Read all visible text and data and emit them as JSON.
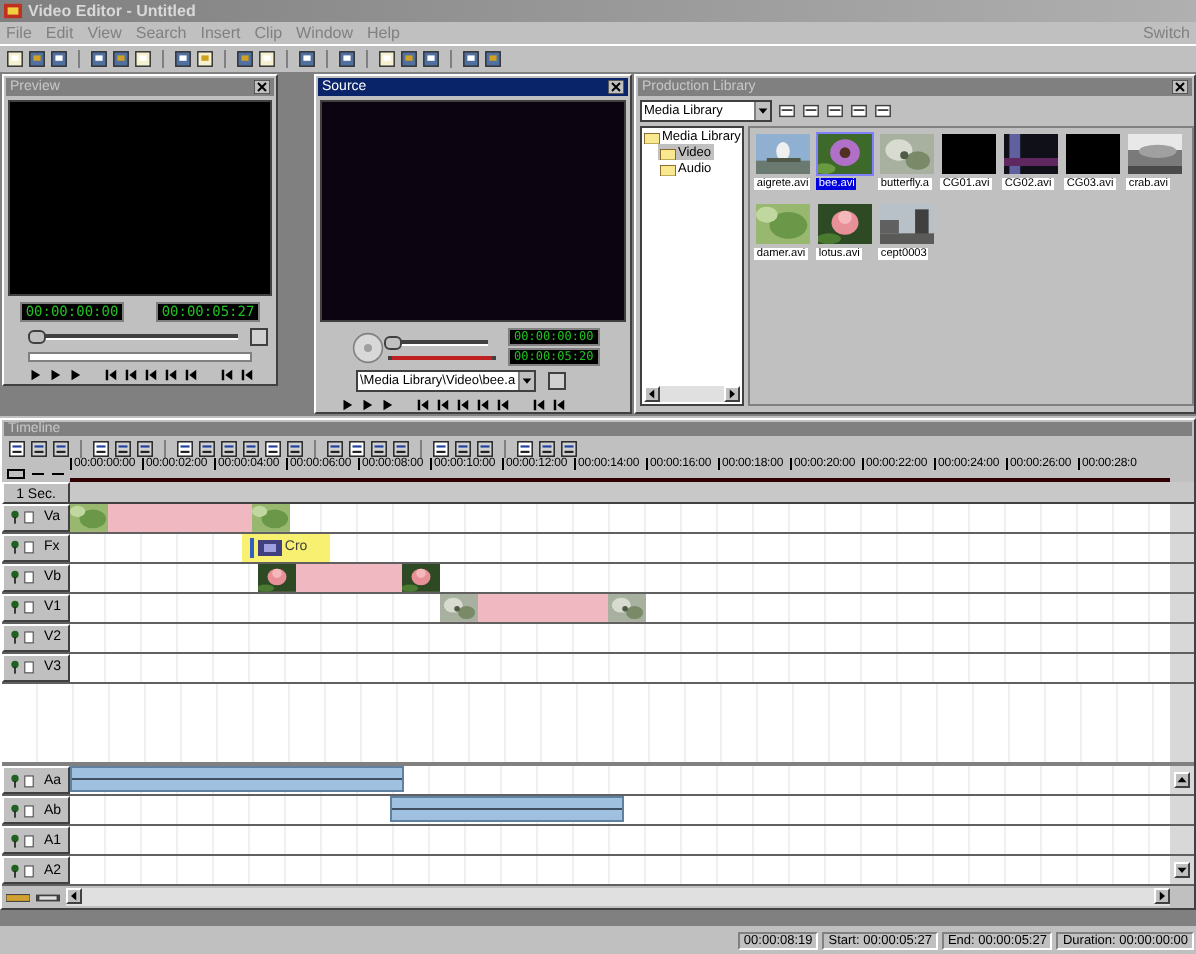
{
  "window": {
    "title": "Video Editor - Untitled"
  },
  "menu": {
    "disabled": true,
    "right": "Switch",
    "items": [
      "File",
      "Edit",
      "View",
      "Search",
      "Insert",
      "Clip",
      "Window",
      "Help"
    ]
  },
  "preview": {
    "title": "Preview",
    "active": false,
    "timecode_current": "00:00:00:00",
    "timecode_end": "00:00:05:27",
    "level": 0.04
  },
  "source": {
    "title": "Source",
    "active": true,
    "timecode_in": "00:00:00:00",
    "timecode_out": "00:00:05:20",
    "level": 0.04,
    "path": "\\Media Library\\Video\\bee.a"
  },
  "library": {
    "title": "Production Library",
    "active": false,
    "dropdown": "Media Library",
    "tree": [
      {
        "label": "Media Library",
        "expanded": true,
        "selected": false,
        "children": [
          {
            "label": "Video",
            "selected": true
          },
          {
            "label": "Audio",
            "selected": false
          }
        ]
      }
    ],
    "items": [
      {
        "name": "aigrete.avi",
        "selected": false,
        "kind": "picture"
      },
      {
        "name": "bee.avi",
        "selected": true,
        "kind": "picture"
      },
      {
        "name": "butterfly.a",
        "selected": false,
        "kind": "picture"
      },
      {
        "name": "CG01.avi",
        "selected": false,
        "kind": "blank"
      },
      {
        "name": "CG02.avi",
        "selected": false,
        "kind": "picture"
      },
      {
        "name": "CG03.avi",
        "selected": false,
        "kind": "blank"
      },
      {
        "name": "crab.avi",
        "selected": false,
        "kind": "picture"
      },
      {
        "name": "damer.avi",
        "selected": false,
        "kind": "picture"
      },
      {
        "name": "lotus.avi",
        "selected": false,
        "kind": "picture"
      },
      {
        "name": "cept0003",
        "selected": false,
        "kind": "picture"
      }
    ]
  },
  "timeline": {
    "title": "Timeline",
    "active": false,
    "scale": "1 Sec.",
    "ruler": [
      "00:00:00:00",
      "00:00:02:00",
      "00:00:04:00",
      "00:00:06:00",
      "00:00:08:00",
      "00:00:10:00",
      "00:00:12:00",
      "00:00:14:00",
      "00:00:16:00",
      "00:00:18:00",
      "00:00:20:00",
      "00:00:22:00",
      "00:00:24:00",
      "00:00:26:00",
      "00:00:28:0"
    ],
    "video_tracks": [
      {
        "name": "Va",
        "clips": [
          {
            "kind": "video"
          }
        ]
      },
      {
        "name": "Fx",
        "clips": [
          {
            "kind": "fx",
            "label": "Cro"
          }
        ]
      },
      {
        "name": "Vb",
        "clips": [
          {
            "kind": "video"
          }
        ]
      },
      {
        "name": "V1",
        "clips": [
          {
            "kind": "video"
          }
        ]
      },
      {
        "name": "V2"
      },
      {
        "name": "V3"
      }
    ],
    "audio_tracks": [
      {
        "name": "Aa",
        "clips": [
          {
            "kind": "audio"
          }
        ]
      },
      {
        "name": "Ab",
        "clips": [
          {
            "kind": "audio"
          }
        ]
      },
      {
        "name": "A1"
      },
      {
        "name": "A2"
      }
    ]
  },
  "status_bar": [
    "00:00:08:19",
    "Start: 00:00:05:27",
    "End: 00:00:05:27",
    "Duration: 00:00:00:00"
  ]
}
